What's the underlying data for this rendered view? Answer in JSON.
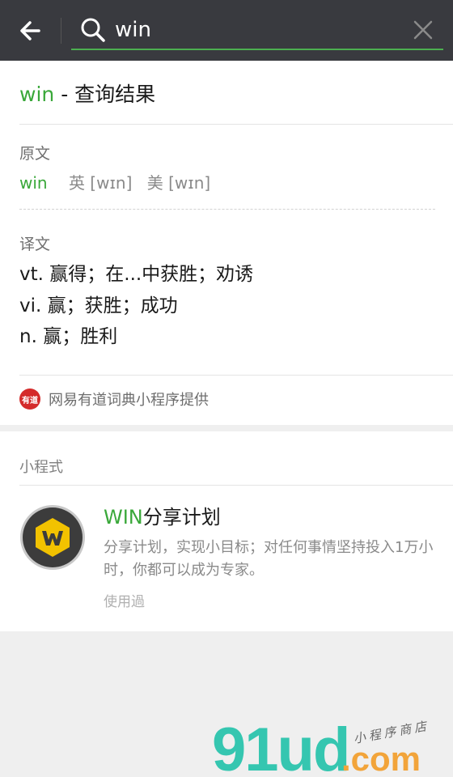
{
  "search": {
    "query": "win"
  },
  "result": {
    "keyword": "win",
    "title_suffix": " - 查询结果",
    "original_label": "原文",
    "word": "win",
    "phonetic_uk": "英 [wɪn]",
    "phonetic_us": "美 [wɪn]",
    "translation_label": "译文",
    "definitions": [
      "vt. 赢得；在...中获胜；劝诱",
      "vi. 赢；获胜；成功",
      "n. 赢；胜利"
    ],
    "provider_logo_text": "有道",
    "provider_text": "网易有道词典小程序提供"
  },
  "mini_programs": {
    "section_label": "小程式",
    "items": [
      {
        "name_highlight": "WIN",
        "name_rest": "分享计划",
        "description": "分享计划，实现小目标；对任何事情坚持投入1万小时，你都可以成为专家。",
        "status": "使用過"
      }
    ]
  },
  "watermark": {
    "main": "91ud",
    "suffix": ".com",
    "tagline": "小程序商店"
  },
  "colors": {
    "topbar": "#393a3f",
    "accent_green": "#3aa83a",
    "provider_red": "#d42b2b"
  }
}
